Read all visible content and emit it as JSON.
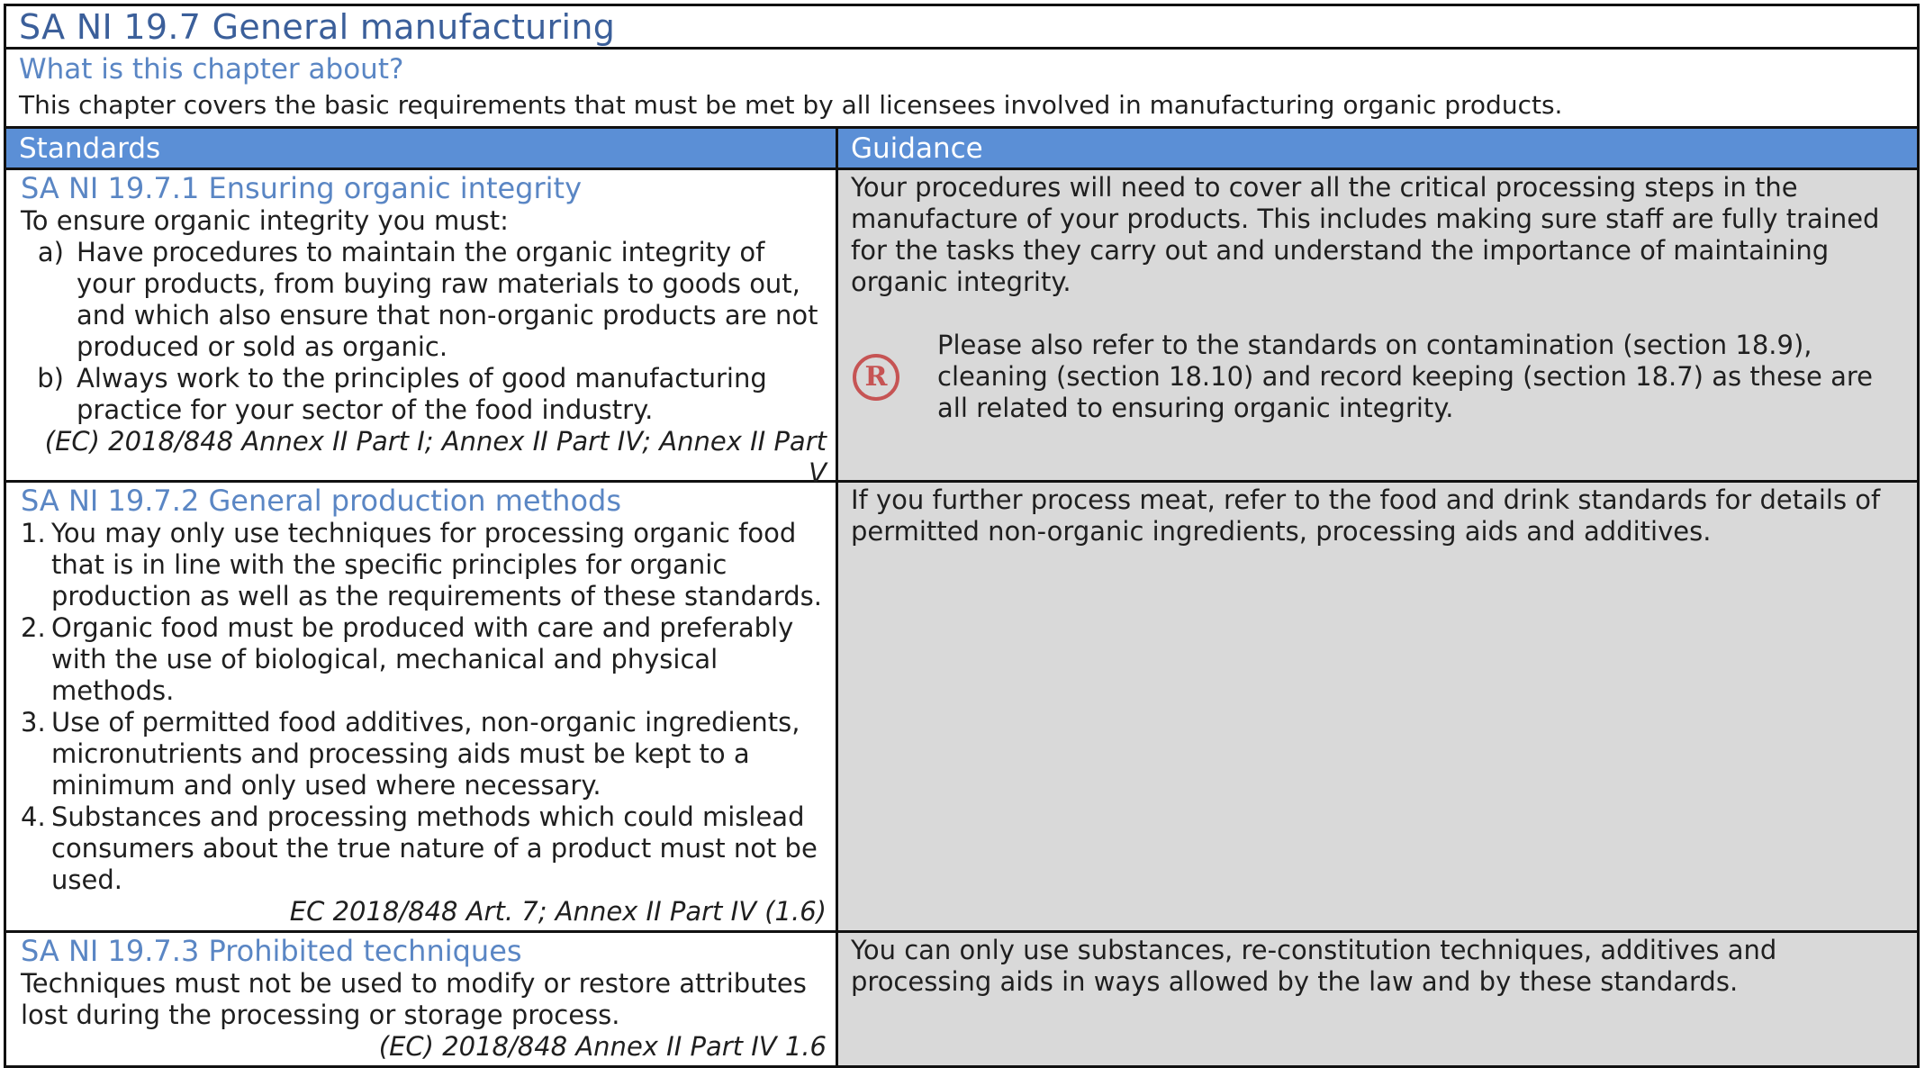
{
  "title": "SA NI 19.7 General manufacturing",
  "about": {
    "heading": "What is this chapter about?",
    "text": "This chapter covers the basic requirements that must be met by all licensees involved in manufacturing organic products."
  },
  "table": {
    "col_standards": "Standards",
    "col_guidance": "Guidance"
  },
  "sections": [
    {
      "title": "SA NI 19.7.1 Ensuring organic integrity",
      "intro": "To ensure organic integrity you must:",
      "items": [
        {
          "marker": "a)",
          "text": "Have procedures to maintain the organic integrity of your products, from buying raw materials to goods out, and which also ensure that non-organic products are not produced or sold as organic."
        },
        {
          "marker": "b)",
          "text": "Always work to the principles of good manufacturing practice for your sector of the food industry."
        }
      ],
      "reference": "(EC) 2018/848 Annex II Part I; Annex II Part IV; Annex II Part V",
      "guidance": "Your procedures will need to cover all the critical processing steps in the manufacture of your products. This includes making sure staff are fully trained for the tasks they carry out and understand the importance of maintaining organic integrity.",
      "note_icon": "R",
      "note": "Please also refer to the standards on contamination (section 18.9), cleaning (section 18.10) and record keeping (section 18.7) as these are all related to ensuring organic integrity."
    },
    {
      "title": "SA NI 19.7.2 General production methods",
      "items": [
        {
          "marker": "1.",
          "text": "You may only use techniques for processing organic food that is in line with the specific principles for organic production as well as the requirements of these standards."
        },
        {
          "marker": "2.",
          "text": "Organic food must be produced with care and preferably with the use of biological, mechanical and physical methods."
        },
        {
          "marker": "3.",
          "text": "Use of permitted food additives, non-organic ingredients, micronutrients and processing aids must be kept to a minimum and only used where necessary."
        },
        {
          "marker": "4.",
          "text": "Substances and processing methods which could mislead consumers about the true nature of a product must not be used."
        }
      ],
      "reference": "EC 2018/848 Art. 7; Annex II Part IV (1.6)",
      "guidance": "If you further process meat, refer to the food and drink standards for details of permitted non-organic ingredients, processing aids and additives."
    },
    {
      "title": "SA NI 19.7.3 Prohibited techniques",
      "intro": "Techniques must not be used to modify or restore attributes lost during the processing or storage process.",
      "reference": "(EC) 2018/848 Annex II Part IV 1.6",
      "guidance": "You can only use substances, re-constitution techniques, additives and processing aids in ways allowed by the law and by these standards."
    }
  ]
}
